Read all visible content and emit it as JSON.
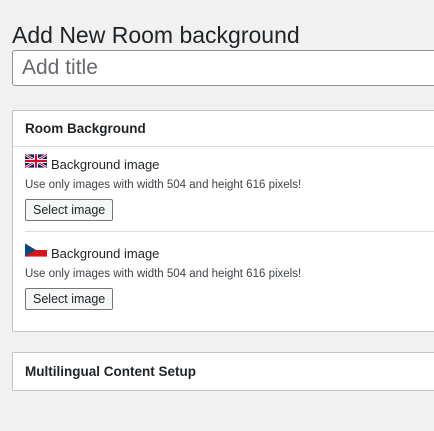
{
  "page": {
    "title": "Add New Room background"
  },
  "title_field": {
    "placeholder": "Add title",
    "value": ""
  },
  "room_background_box": {
    "heading": "Room Background",
    "fields": [
      {
        "flag_icon": "uk-flag-icon",
        "label": "Background image",
        "hint": "Use only images with width 504 and height 616 pixels!",
        "button_label": "Select image"
      },
      {
        "flag_icon": "czech-flag-icon",
        "label": "Background image",
        "hint": "Use only images with width 504 and height 616 pixels!",
        "button_label": "Select image"
      }
    ]
  },
  "multilingual_box": {
    "heading": "Multilingual Content Setup"
  },
  "colors": {
    "background": "#f1f1f1",
    "panel": "#ffffff",
    "border": "#c3c4c7",
    "text": "#1d2327"
  }
}
